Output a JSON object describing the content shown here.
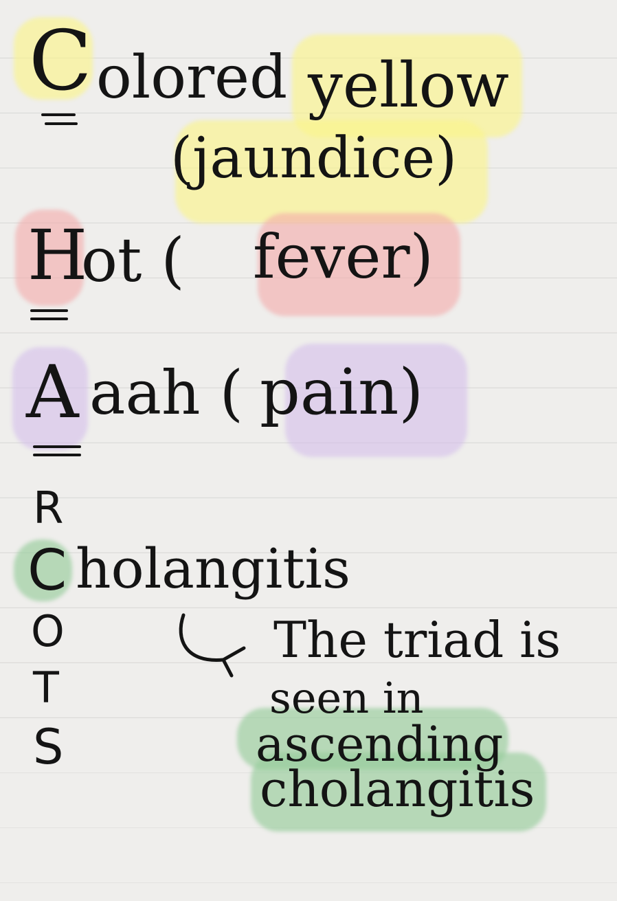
{
  "mnemonic": {
    "line_c": {
      "letter": "C",
      "rest": "olored",
      "keyword": "yellow",
      "explanation": "(jaundice)"
    },
    "line_h": {
      "letter": "H",
      "rest": "ot (",
      "keyword": "fever",
      "close": ")"
    },
    "line_a": {
      "letter": "A",
      "rest": "aah (",
      "keyword": "pain",
      "close": ")"
    },
    "letters": [
      "R",
      "C",
      "O",
      "T",
      "S"
    ],
    "cholangitis_rest": "holangitis"
  },
  "note": {
    "line1": "The triad is",
    "line2": "seen in",
    "line3": "ascending",
    "line4": "cholangitis"
  },
  "colors": {
    "yellow_highlight": "#faf58c",
    "pink_highlight": "#f4aaaa",
    "purple_highlight": "#d2b9eb",
    "green_highlight": "#96cd9b",
    "ink": "#141414",
    "paper": "#efeeec"
  }
}
